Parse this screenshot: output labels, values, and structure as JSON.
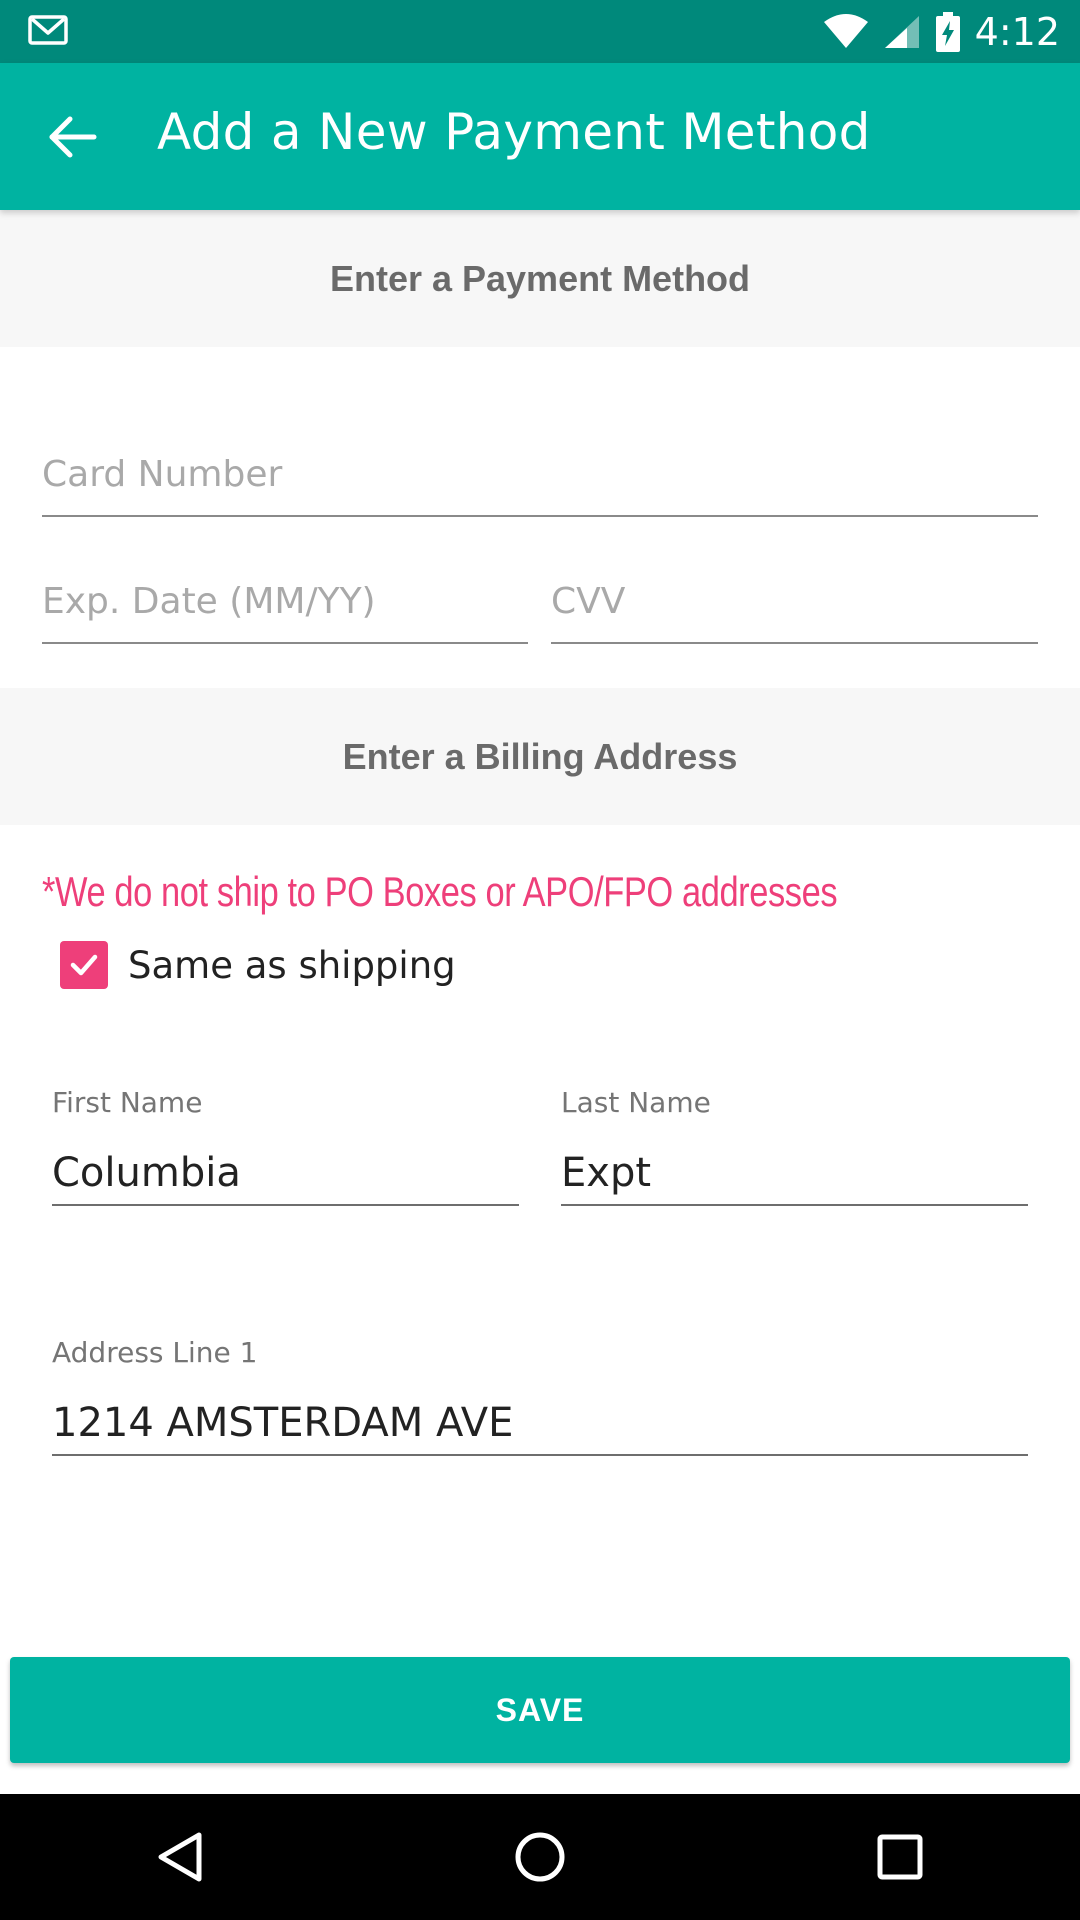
{
  "status_bar": {
    "time": "4:12"
  },
  "app_bar": {
    "title": "Add a New Payment Method"
  },
  "payment_section": {
    "header": "Enter a Payment Method",
    "card_number_placeholder": "Card Number",
    "exp_date_placeholder": "Exp. Date (MM/YY)",
    "cvv_placeholder": "CVV"
  },
  "billing_section": {
    "header": "Enter a Billing Address",
    "notice": "*We do not ship to PO Boxes or APO/FPO addresses",
    "same_as_shipping_label": "Same as shipping",
    "same_as_shipping_checked": true,
    "first_name_label": "First Name",
    "first_name_value": "Columbia",
    "last_name_label": "Last Name",
    "last_name_value": "Expt",
    "address1_label": "Address Line 1",
    "address1_value": "1214 AMSTERDAM AVE"
  },
  "save_button": {
    "label": "SAVE"
  },
  "colors": {
    "primary": "#00b3a1",
    "status_bar": "#00897b",
    "accent": "#ee3f7a",
    "section_bg": "#f7f7f7"
  },
  "icons": {
    "status_left": "mail-icon",
    "status_right": [
      "wifi-icon",
      "signal-icon",
      "battery-charging-icon"
    ],
    "app_bar": "back-arrow-icon",
    "nav": [
      "nav-back-icon",
      "nav-home-icon",
      "nav-recents-icon"
    ]
  }
}
